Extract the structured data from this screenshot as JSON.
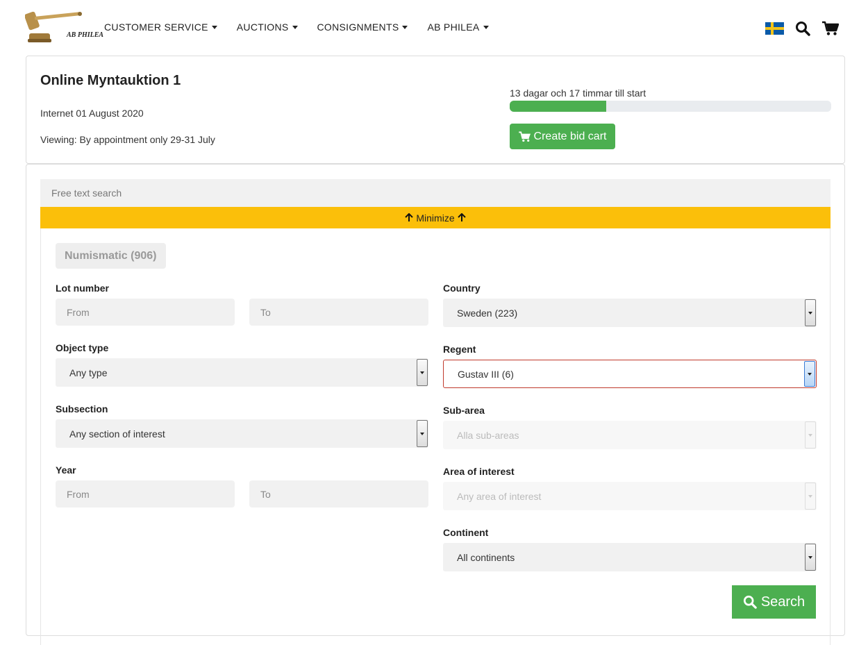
{
  "brand": {
    "name": "AB PHILEA"
  },
  "nav": {
    "menu": [
      {
        "label": "CUSTOMER SERVICE"
      },
      {
        "label": "AUCTIONS"
      },
      {
        "label": "CONSIGNMENTS"
      },
      {
        "label": "AB PHILEA"
      }
    ],
    "icons": [
      "swedish-flag-icon",
      "search-icon",
      "cart-icon"
    ]
  },
  "auction": {
    "title": "Online Myntauktion 1",
    "date": "Internet 01 August 2020",
    "viewing": "Viewing: By appointment only 29-31 July",
    "countdown": "13 dagar och 17 timmar till start",
    "progress_fraction": 0.3,
    "bid_cart_label": "Create bid cart"
  },
  "search": {
    "free_text_placeholder": "Free text search",
    "minimize_label": "Minimize",
    "category_chip": "Numismatic (906)",
    "search_button": "Search"
  },
  "filters": {
    "lot_number": {
      "label": "Lot number",
      "from": "From",
      "to": "To"
    },
    "object_type": {
      "label": "Object type",
      "value": "Any type"
    },
    "subsection": {
      "label": "Subsection",
      "value": "Any section of interest"
    },
    "year": {
      "label": "Year",
      "from": "From",
      "to": "To"
    },
    "country": {
      "label": "Country",
      "value": "Sweden (223)"
    },
    "regent": {
      "label": "Regent",
      "value": "Gustav III (6)"
    },
    "sub_area": {
      "label": "Sub-area",
      "value": "Alla sub-areas"
    },
    "area_of_interest": {
      "label": "Area of interest",
      "value": "Any area of interest"
    },
    "continent": {
      "label": "Continent",
      "value": "All continents"
    }
  },
  "colors": {
    "accent_green": "#4caf50",
    "minimize_yellow": "#fbbf0a",
    "regent_border_red": "#c0392b"
  }
}
